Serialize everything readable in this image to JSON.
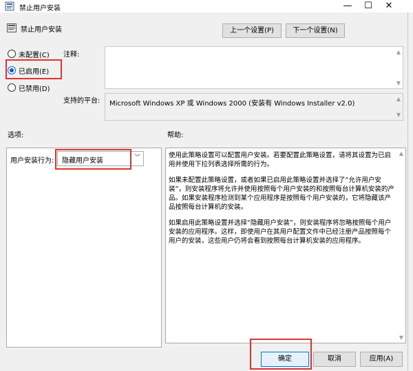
{
  "window": {
    "title": "禁止用户安装",
    "minimize_icon": "minimize-icon",
    "maximize_icon": "maximize-icon",
    "close_icon": "close-icon"
  },
  "header": {
    "policy_name": "禁止用户安装",
    "prev_button": "上一个设置(P)",
    "next_button": "下一个设置(N)"
  },
  "state": {
    "options": [
      {
        "label": "未配置(C)",
        "checked": false
      },
      {
        "label": "已启用(E)",
        "checked": true
      },
      {
        "label": "已禁用(D)",
        "checked": false
      }
    ]
  },
  "comment": {
    "label": "注释:",
    "value": ""
  },
  "platform": {
    "label": "支持的平台:",
    "value": "Microsoft Windows XP 或 Windows 2000 (安装有 Windows Installer v2.0)"
  },
  "sections": {
    "options_label": "选项:",
    "help_label": "帮助:"
  },
  "options_panel": {
    "behavior_label": "用户安装行为:",
    "behavior_value": "隐藏用户安装"
  },
  "help": {
    "paragraphs": [
      "使用此策略设置可以配置用户安装。若要配置此策略设置，请将其设置为已启用并使用下拉列表选择所需的行为。",
      "如果未配置此策略设置，或者如果已启用此策略设置并选择了“允许用户安装”，则安装程序将允许并使用按照每个用户安装的和按照每台计算机安装的产品。如果安装程序检测到某个应用程序是按照每个用户安装的，它将隐藏该产品按照每台计算机的安装。",
      "如果启用此策略设置并选择“隐藏用户安装”，则安装程序将忽略按照每个用户安装的应用程序。这样，即使用户在其用户配置文件中已经注册产品按照每个用户的安装，这些用户仍将会看到按照每台计算机安装的应用程序。"
    ]
  },
  "footer": {
    "ok": "确定",
    "cancel": "取消",
    "apply": "应用(A)"
  },
  "colors": {
    "highlight_box": "#e0322e",
    "radio_accent": "#0a5cd6",
    "ok_border": "#0078d7"
  }
}
